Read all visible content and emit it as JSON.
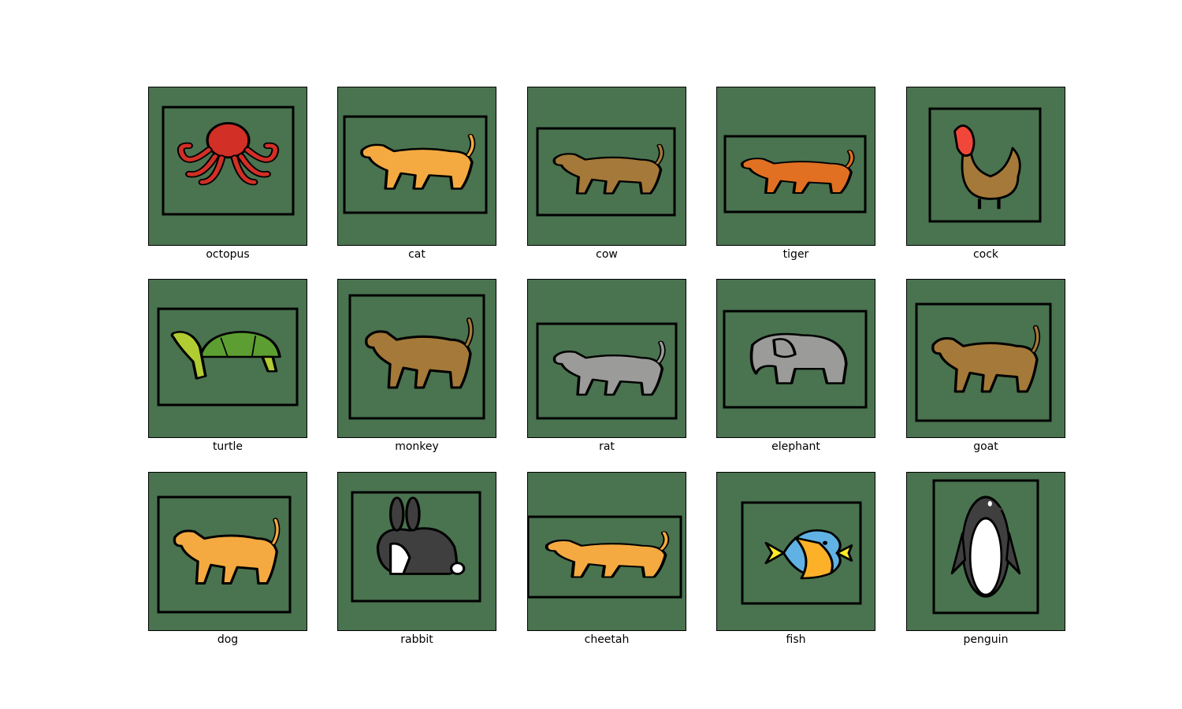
{
  "colors": {
    "tile_background": "#4a7350",
    "frame": "#000000",
    "caption_text": "#000000"
  },
  "items": [
    {
      "label": "octopus",
      "icon": "octopus-icon",
      "body_color": "#d22f27"
    },
    {
      "label": "cat",
      "icon": "cat-icon",
      "body_color": "#f4aa41"
    },
    {
      "label": "cow",
      "icon": "cow-icon",
      "body_color": "#a57939"
    },
    {
      "label": "tiger",
      "icon": "tiger-icon",
      "body_color": "#e27022"
    },
    {
      "label": "cock",
      "icon": "cock-icon",
      "body_color": "#a57939"
    },
    {
      "label": "turtle",
      "icon": "turtle-icon",
      "body_color": "#5c9e31"
    },
    {
      "label": "monkey",
      "icon": "monkey-icon",
      "body_color": "#a57939"
    },
    {
      "label": "rat",
      "icon": "rat-icon",
      "body_color": "#9b9b9a"
    },
    {
      "label": "elephant",
      "icon": "elephant-icon",
      "body_color": "#9b9b9a"
    },
    {
      "label": "goat",
      "icon": "goat-icon",
      "body_color": "#a57939"
    },
    {
      "label": "dog",
      "icon": "dog-icon",
      "body_color": "#f4aa41"
    },
    {
      "label": "rabbit",
      "icon": "rabbit-icon",
      "body_color": "#3f3f3f"
    },
    {
      "label": "cheetah",
      "icon": "cheetah-icon",
      "body_color": "#f4aa41"
    },
    {
      "label": "fish",
      "icon": "fish-icon",
      "body_color": "#61b2e4"
    },
    {
      "label": "penguin",
      "icon": "penguin-icon",
      "body_color": "#ffffff"
    }
  ]
}
